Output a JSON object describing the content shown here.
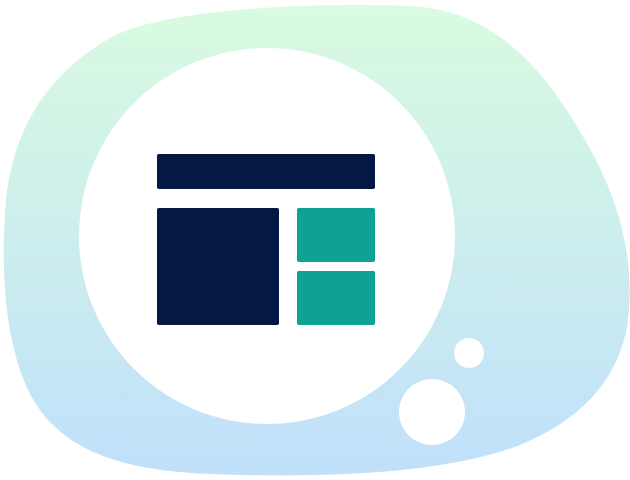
{
  "illustration": {
    "icon": "layout-grid-icon",
    "colors": {
      "blob_top": "#d9fbe0",
      "blob_bottom": "#c0e0fb",
      "circle": "#ffffff",
      "primary_block": "#031944",
      "accent_block": "#0fa096",
      "bubble": "#ffffff"
    }
  }
}
